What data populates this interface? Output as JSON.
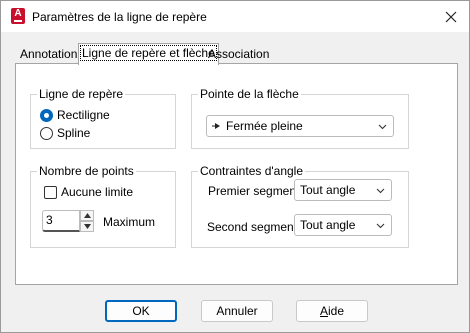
{
  "window": {
    "title": "Paramètres de la ligne de repère",
    "app_icon_letter": "A"
  },
  "tabs": [
    {
      "label": "Annotation",
      "active": false
    },
    {
      "label": "Ligne de repère et flèche",
      "active": true
    },
    {
      "label": "Association",
      "active": false
    }
  ],
  "leader_line": {
    "title": "Ligne de repère",
    "options": [
      {
        "label": "Rectiligne",
        "selected": true
      },
      {
        "label": "Spline",
        "selected": false
      }
    ]
  },
  "arrowhead": {
    "title": "Pointe de la flèche",
    "value": "Fermée pleine"
  },
  "number_of_points": {
    "title": "Nombre de points",
    "no_limit_label": "Aucune limite",
    "no_limit_checked": false,
    "maximum_value": "3",
    "maximum_label": "Maximum"
  },
  "angle_constraints": {
    "title": "Contraintes d'angle",
    "first_segment_label": "Premier segment:",
    "first_segment_value": "Tout angle",
    "second_segment_label": "Second segment:",
    "second_segment_value": "Tout angle"
  },
  "buttons": {
    "ok": "OK",
    "cancel": "Annuler",
    "help": "Aide"
  },
  "colors": {
    "accent": "#0067c0",
    "app_icon": "#c8102e"
  }
}
